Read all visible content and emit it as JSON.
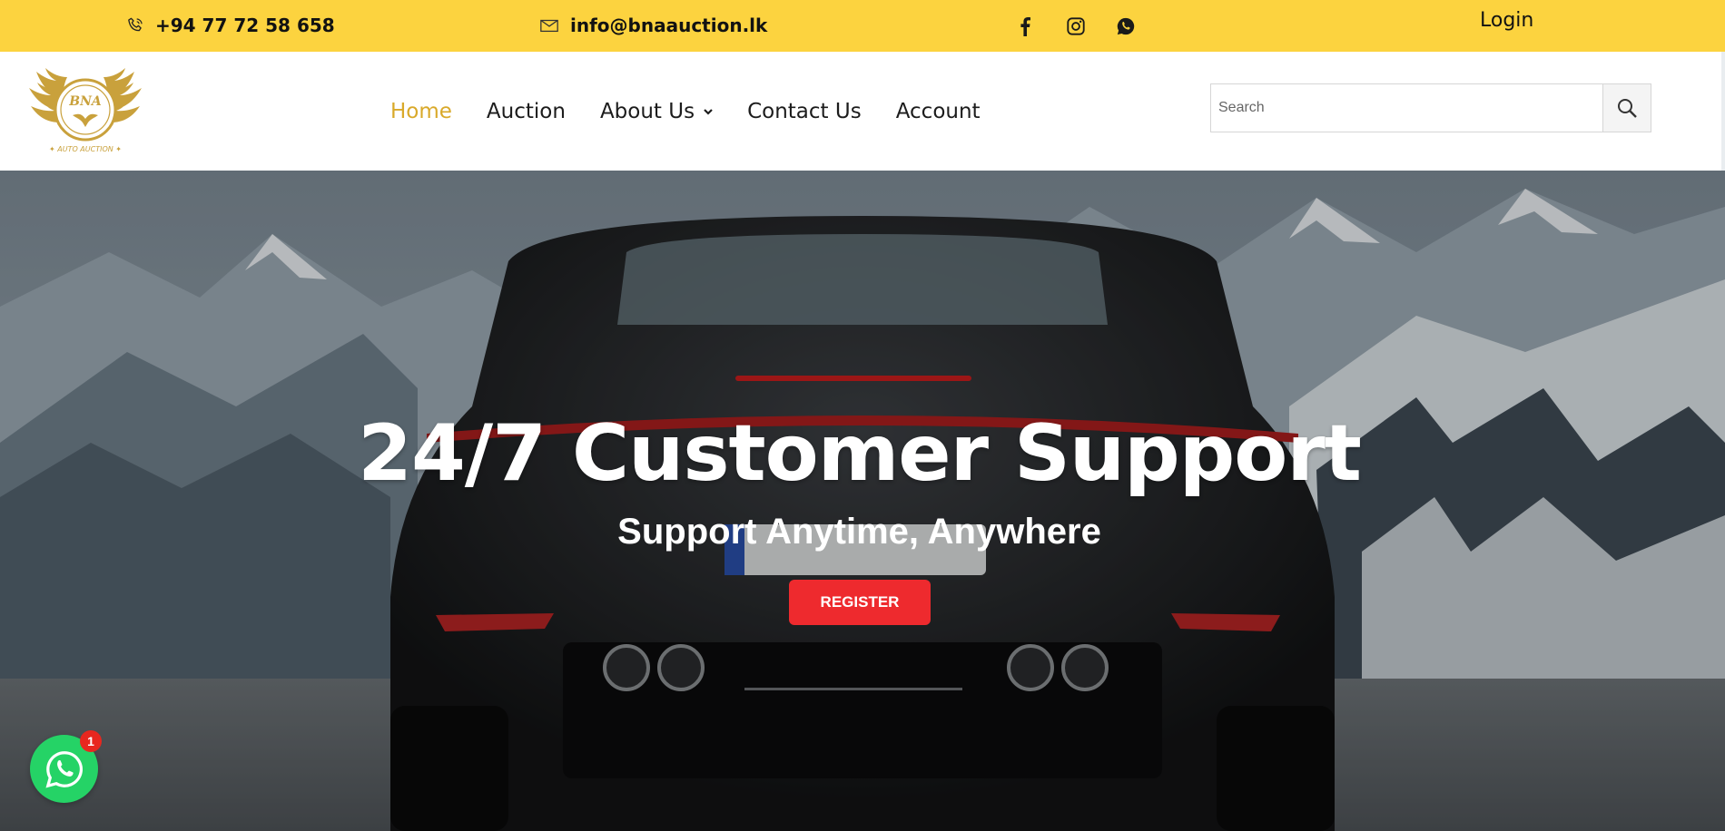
{
  "topbar": {
    "phone": "+94 77 72 58 658",
    "email": "info@bnaauction.lk",
    "social": [
      "facebook-icon",
      "instagram-icon",
      "whatsapp-icon"
    ],
    "login_label": "Login",
    "background": "#fcd33f"
  },
  "header": {
    "nav": {
      "home": "Home",
      "auction": "Auction",
      "about": "About Us",
      "contact": "Contact Us",
      "account": "Account"
    },
    "active_color": "#d9a92a",
    "search": {
      "placeholder": "Search"
    }
  },
  "hero": {
    "title": "24/7 Customer Support",
    "subtitle": "Support Anytime, Anywhere",
    "button": "REGISTER",
    "button_color": "#ee2a2e"
  },
  "whatsapp_widget": {
    "badge": "1",
    "color": "#25d366"
  }
}
